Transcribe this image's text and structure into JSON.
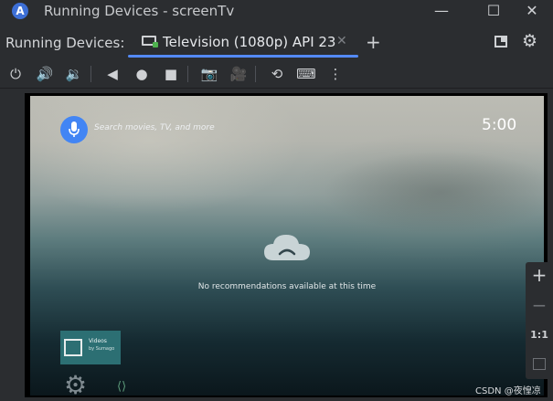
{
  "window": {
    "title": "Running Devices - screenTv",
    "min_glyph": "—",
    "max_glyph": "☐",
    "close_glyph": "✕"
  },
  "tabbar": {
    "label": "Running Devices:",
    "tab_title": "Television (1080p) API 23",
    "tab_close": "✕",
    "add_glyph": "+",
    "settings_glyph": "⚙"
  },
  "toolbar": {
    "items": [
      {
        "name": "power-icon",
        "glyph": "⏻"
      },
      {
        "name": "volume-up-icon",
        "glyph": "🔊"
      },
      {
        "name": "volume-down-icon",
        "glyph": "🔉"
      },
      {
        "name": "back-icon",
        "glyph": "◀"
      },
      {
        "name": "home-icon",
        "glyph": "●"
      },
      {
        "name": "overview-icon",
        "glyph": "■"
      },
      {
        "name": "screenshot-icon",
        "glyph": "📷"
      },
      {
        "name": "screen-record-icon",
        "glyph": "🎥"
      },
      {
        "name": "snapshot-icon",
        "glyph": "⟲"
      },
      {
        "name": "keyboard-icon",
        "glyph": "⌨"
      },
      {
        "name": "more-icon",
        "glyph": "⋮"
      }
    ]
  },
  "tv": {
    "search_hint": "Search movies, TV, and more",
    "clock": "5:00",
    "no_recommendations": "No recommendations available at this time",
    "videos_card_title": "Videos",
    "videos_card_sub": "by Sumago"
  },
  "zoom": {
    "zoom_in": "+",
    "zoom_out": "−",
    "actual": "1:1"
  },
  "watermark": "CSDN @夜惶凉",
  "colors": {
    "accent": "#548af7",
    "mic": "#4285f4",
    "videos_card": "#2c6f73",
    "background": "#2b2d30"
  }
}
